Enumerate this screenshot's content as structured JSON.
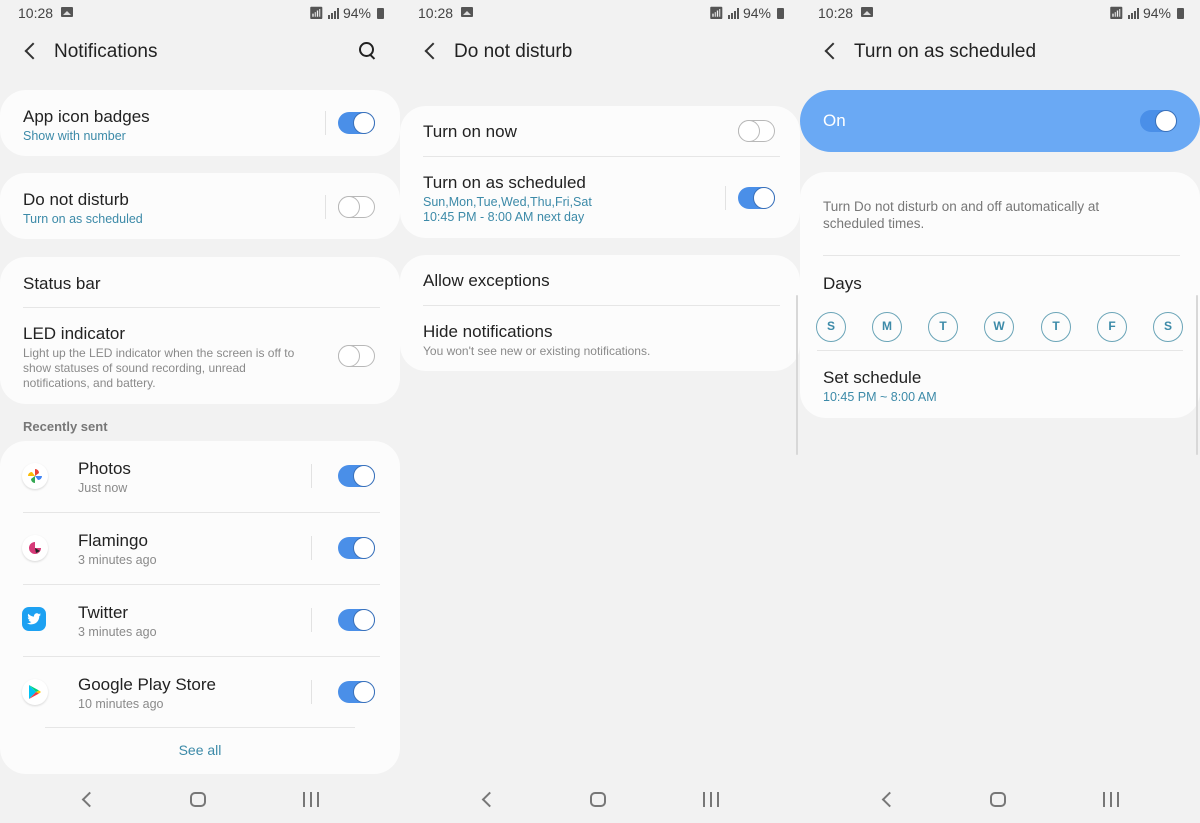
{
  "status_bar": {
    "time": "10:28",
    "battery": "94%"
  },
  "panel1": {
    "title": "Notifications",
    "app_icon_badges": {
      "title": "App icon badges",
      "subtitle": "Show with number",
      "enabled": true
    },
    "do_not_disturb": {
      "title": "Do not disturb",
      "subtitle": "Turn on as scheduled",
      "enabled": false
    },
    "status_bar_item": {
      "title": "Status bar"
    },
    "led_indicator": {
      "title": "LED indicator",
      "description": "Light up the LED indicator when the screen is off to show statuses of sound recording, unread notifications, and battery.",
      "enabled": false
    },
    "recently_sent_label": "Recently sent",
    "apps": [
      {
        "name": "Photos",
        "time": "Just now",
        "icon": "photos-icon",
        "enabled": true
      },
      {
        "name": "Flamingo",
        "time": "3 minutes ago",
        "icon": "flamingo-icon",
        "enabled": true
      },
      {
        "name": "Twitter",
        "time": "3 minutes ago",
        "icon": "twitter-icon",
        "enabled": true
      },
      {
        "name": "Google Play Store",
        "time": "10 minutes ago",
        "icon": "play-store-icon",
        "enabled": true
      }
    ],
    "see_all": "See all"
  },
  "panel2": {
    "title": "Do not disturb",
    "turn_on_now": {
      "title": "Turn on now",
      "enabled": false
    },
    "turn_on_scheduled": {
      "title": "Turn on as scheduled",
      "days": "Sun,Mon,Tue,Wed,Thu,Fri,Sat",
      "time": "10:45 PM - 8:00 AM next day",
      "enabled": true
    },
    "allow_exceptions": {
      "title": "Allow exceptions"
    },
    "hide_notifications": {
      "title": "Hide notifications",
      "description": "You won't see new or existing notifications."
    }
  },
  "panel3": {
    "title": "Turn on as scheduled",
    "on_label": "On",
    "on_enabled": true,
    "description": "Turn Do not disturb on and off automatically at scheduled times.",
    "days_label": "Days",
    "days": [
      "S",
      "M",
      "T",
      "W",
      "T",
      "F",
      "S"
    ],
    "set_schedule": {
      "title": "Set schedule",
      "time": "10:45 PM ~ 8:00 AM"
    }
  },
  "colors": {
    "accent": "#4a8fe8",
    "on_card": "#6aa9f4",
    "link": "#3c8aa8",
    "background": "#f2f2f2"
  }
}
